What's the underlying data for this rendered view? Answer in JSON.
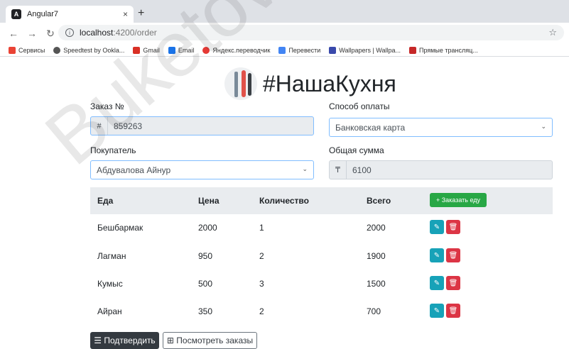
{
  "browser": {
    "tab_title": "Angular7",
    "tab_favicon": "A",
    "close_glyph": "×",
    "newtab_glyph": "+",
    "url_host": "localhost",
    "url_path": ":4200/order",
    "bookmarks": [
      {
        "label": "Сервисы",
        "color": "#ea4335"
      },
      {
        "label": "Speedtest by Ookla...",
        "color": "#555555"
      },
      {
        "label": "Gmail",
        "color": "#d93025"
      },
      {
        "label": "Email",
        "color": "#1a73e8"
      },
      {
        "label": "Яндекс.переводчик",
        "color": "#e53935"
      },
      {
        "label": "Перевести",
        "color": "#4285f4"
      },
      {
        "label": "Wallpapers | Wallpa...",
        "color": "#3949ab"
      },
      {
        "label": "Прямые трансляц...",
        "color": "#c62828"
      }
    ]
  },
  "brand": {
    "title": "#НашаКухня"
  },
  "form": {
    "order_no_label": "Заказ №",
    "order_no_addon": "#",
    "order_no_value": "859263",
    "payment_label": "Способ оплаты",
    "payment_value": "Банковская карта",
    "customer_label": "Покупатель",
    "customer_value": "Абдувалова Айнур",
    "total_label": "Общая сумма",
    "total_addon": "₸",
    "total_value": "6100"
  },
  "table": {
    "headers": {
      "food": "Еда",
      "price": "Цена",
      "qty": "Количество",
      "total": "Всего"
    },
    "order_button": "+ Заказать еду",
    "edit_glyph": "✎",
    "delete_glyph": "🗑",
    "rows": [
      {
        "food": "Бешбармак",
        "price": "2000",
        "qty": "1",
        "total": "2000"
      },
      {
        "food": "Лагман",
        "price": "950",
        "qty": "2",
        "total": "1900"
      },
      {
        "food": "Кумыс",
        "price": "500",
        "qty": "3",
        "total": "1500"
      },
      {
        "food": "Айран",
        "price": "350",
        "qty": "2",
        "total": "700"
      }
    ]
  },
  "actions": {
    "confirm": "☰ Подтвердить",
    "view_orders": "⊞ Посмотреть заказы"
  },
  "watermark": "Buketov"
}
